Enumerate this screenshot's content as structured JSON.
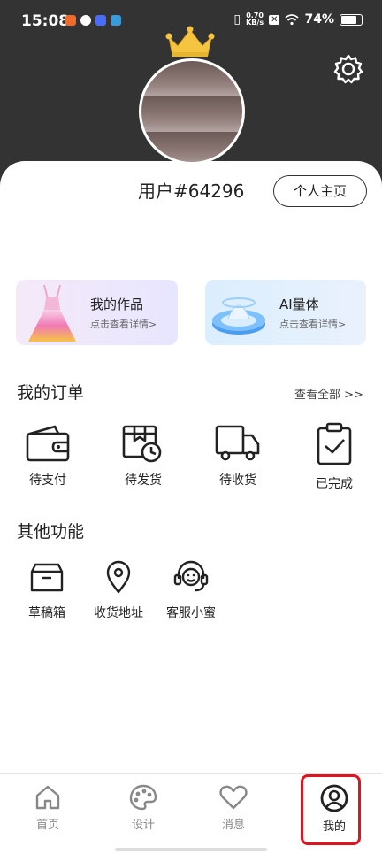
{
  "status_bar": {
    "time": "15:08",
    "net_speed_value": "0.70",
    "net_speed_unit": "KB/s",
    "battery": "74%"
  },
  "profile": {
    "username": "用户#64296",
    "profile_button": "个人主页"
  },
  "feature_cards": [
    {
      "title": "我的作品",
      "subtitle": "点击查看详情>"
    },
    {
      "title": "AI量体",
      "subtitle": "点击查看详情>"
    }
  ],
  "orders": {
    "title": "我的订单",
    "view_all": "查看全部 >>",
    "items": [
      {
        "label": "待支付",
        "icon": "wallet-icon"
      },
      {
        "label": "待发货",
        "icon": "package-clock-icon"
      },
      {
        "label": "待收货",
        "icon": "truck-icon"
      },
      {
        "label": "已完成",
        "icon": "clipboard-check-icon"
      }
    ]
  },
  "other_functions": {
    "title": "其他功能",
    "items": [
      {
        "label": "草稿箱",
        "icon": "box-icon"
      },
      {
        "label": "收货地址",
        "icon": "location-pin-icon"
      },
      {
        "label": "客服小蜜",
        "icon": "headset-icon"
      }
    ]
  },
  "bottom_nav": {
    "items": [
      {
        "label": "首页",
        "icon": "home-icon"
      },
      {
        "label": "设计",
        "icon": "palette-icon"
      },
      {
        "label": "消息",
        "icon": "heart-icon"
      },
      {
        "label": "我的",
        "icon": "user-circle-icon"
      }
    ],
    "active_index": 3
  },
  "colors": {
    "header_bg": "#333333",
    "highlight": "#e0141e",
    "crown": "#f5c542"
  }
}
